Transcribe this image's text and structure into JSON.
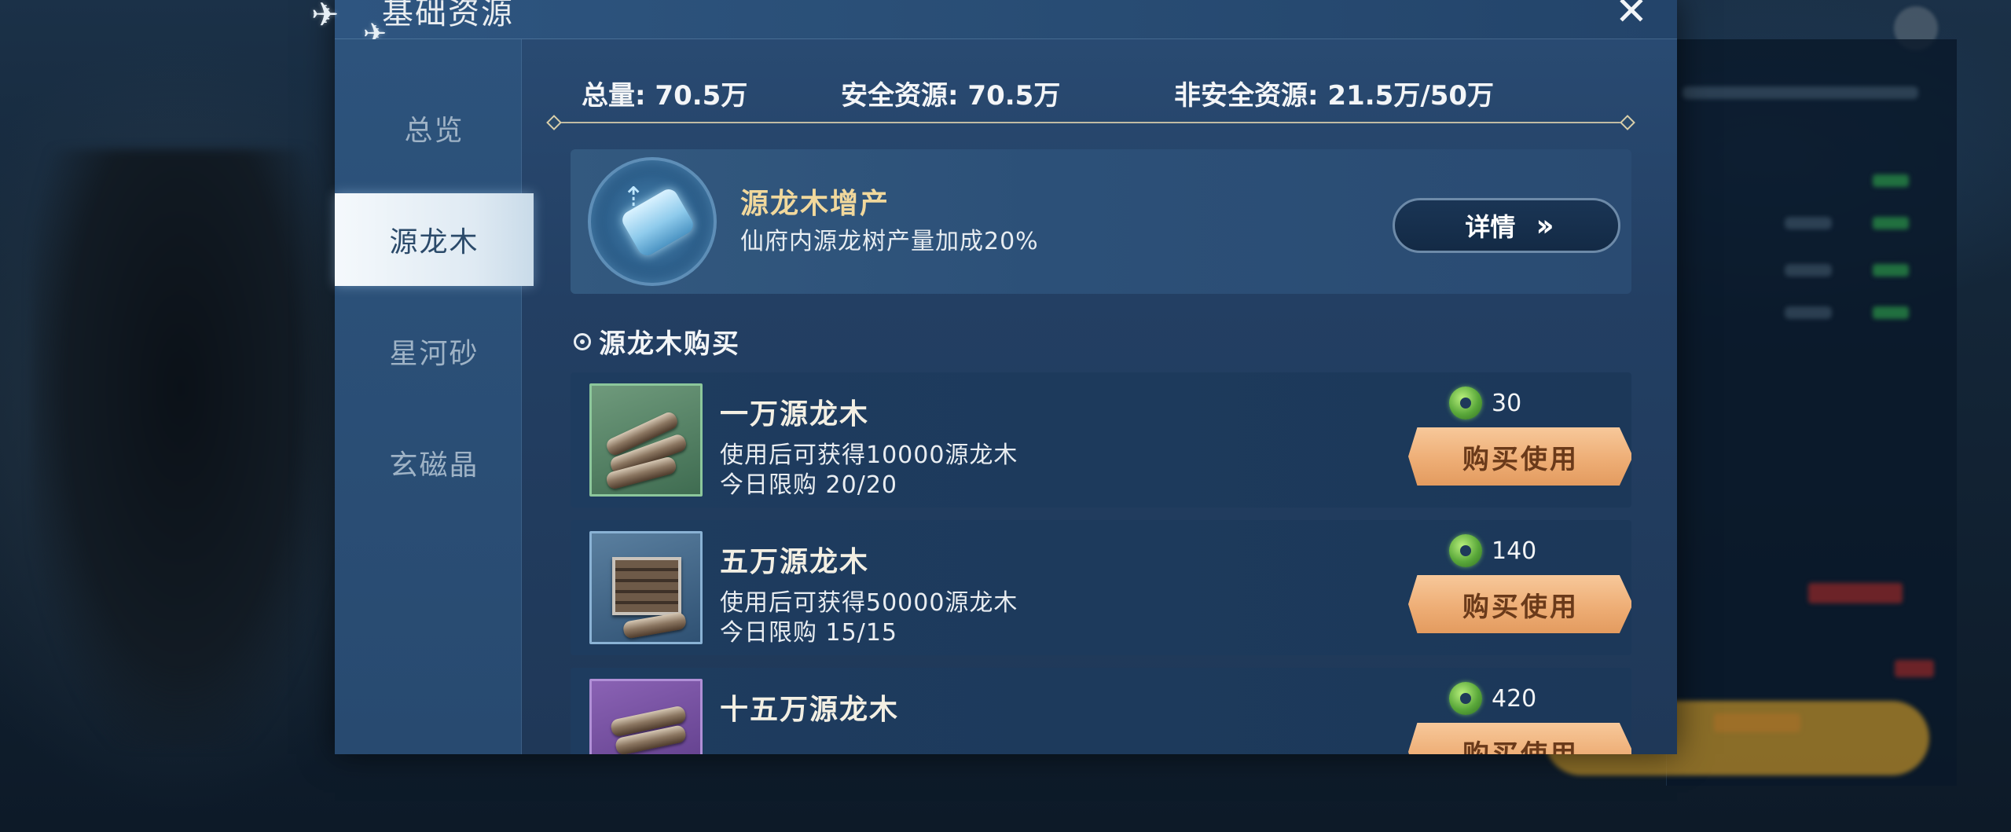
{
  "dialog": {
    "title": "基础资源"
  },
  "tabs": [
    {
      "label": "总览",
      "active": false
    },
    {
      "label": "源龙木",
      "active": true
    },
    {
      "label": "星河砂",
      "active": false
    },
    {
      "label": "玄磁晶",
      "active": false
    }
  ],
  "stats": {
    "total": "总量: 70.5万",
    "safe": "安全资源: 70.5万",
    "unsafe": "非安全资源: 21.5万/50万"
  },
  "bonus": {
    "title": "源龙木增产",
    "desc": "仙府内源龙树产量加成20%",
    "button_label": "详情",
    "button_icon": "double-chevron-right-icon"
  },
  "section": {
    "label": "源龙木购买"
  },
  "items": [
    {
      "name": "一万源龙木",
      "desc": "使用后可获得10000源龙木",
      "limit": "今日限购 20/20",
      "price": "30",
      "button": "购买使用",
      "rarity": "green"
    },
    {
      "name": "五万源龙木",
      "desc": "使用后可获得50000源龙木",
      "limit": "今日限购 15/15",
      "price": "140",
      "button": "购买使用",
      "rarity": "blue"
    },
    {
      "name": "十五万源龙木",
      "desc": "",
      "limit": "",
      "price": "420",
      "button": "购买使用",
      "rarity": "purple"
    }
  ],
  "colors": {
    "accent_gold": "#f1d89c",
    "buy_button": "#eeae76",
    "panel": "#233f63"
  }
}
